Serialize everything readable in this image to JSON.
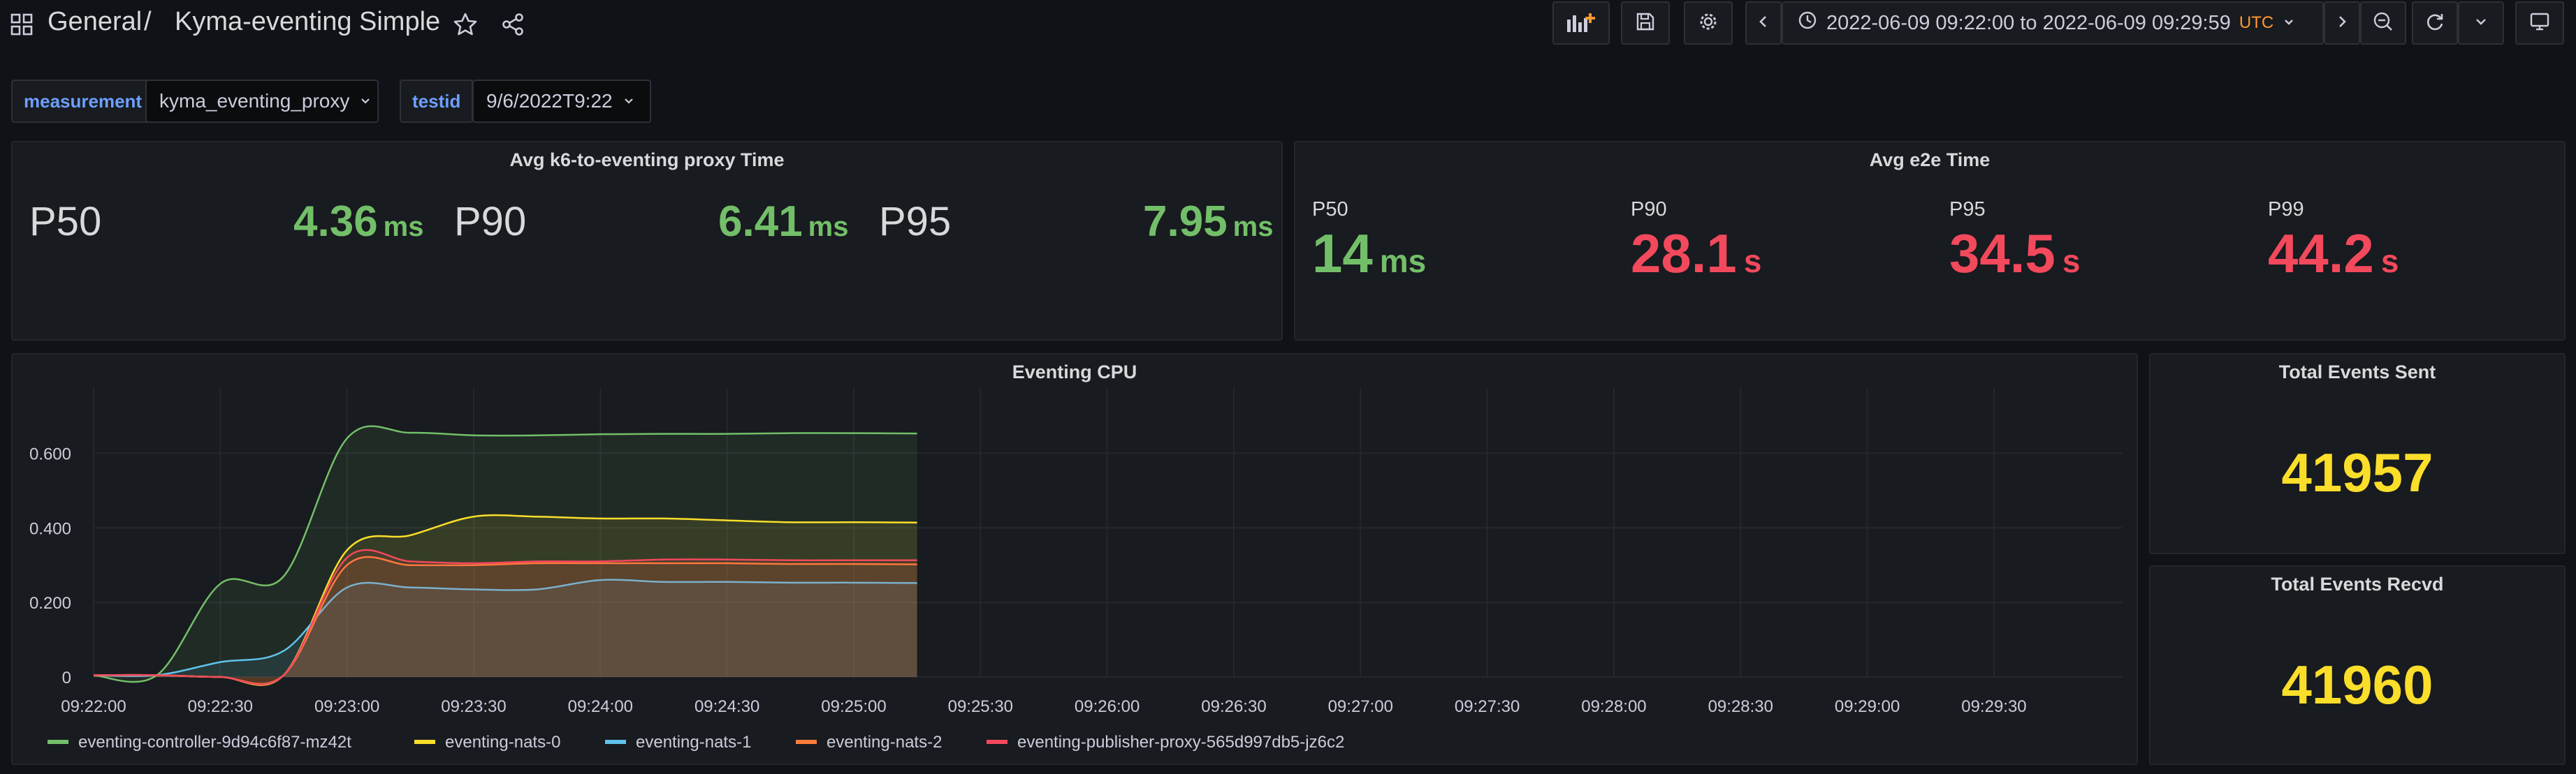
{
  "breadcrumb": {
    "folder": "General",
    "separator": "/",
    "dashboard": "Kyma-eventing Simple"
  },
  "toolbar": {
    "time_range": "2022-06-09 09:22:00 to 2022-06-09 09:29:59",
    "timezone": "UTC"
  },
  "variables": [
    {
      "label": "measurement",
      "value": "kyma_eventing_proxy"
    },
    {
      "label": "testid",
      "value": "9/6/2022T9:22"
    }
  ],
  "panels": {
    "proxy": {
      "title": "Avg k6-to-eventing proxy Time",
      "stats": [
        {
          "name": "P50",
          "value": "4.36",
          "unit": "ms"
        },
        {
          "name": "P90",
          "value": "6.41",
          "unit": "ms"
        },
        {
          "name": "P95",
          "value": "7.95",
          "unit": "ms"
        }
      ]
    },
    "e2e": {
      "title": "Avg e2e Time",
      "stats": [
        {
          "name": "P50",
          "value": "14",
          "unit": "ms"
        },
        {
          "name": "P90",
          "value": "28.1",
          "unit": "s"
        },
        {
          "name": "P95",
          "value": "34.5",
          "unit": "s"
        },
        {
          "name": "P99",
          "value": "44.2",
          "unit": "s"
        }
      ]
    },
    "sent": {
      "title": "Total Events Sent",
      "value": "41957"
    },
    "recvd": {
      "title": "Total Events Recvd",
      "value": "41960"
    }
  },
  "colors": {
    "background": "#111217",
    "panel": "#181b1f",
    "green": "#73bf69",
    "red": "#f2495c",
    "yellow": "#fade2a",
    "orange_utc": "#ff9830"
  },
  "chart_data": {
    "type": "area",
    "title": "Eventing CPU",
    "xlabel": "",
    "ylabel": "",
    "x_ticks": [
      "09:22:00",
      "09:22:30",
      "09:23:00",
      "09:23:30",
      "09:24:00",
      "09:24:30",
      "09:25:00",
      "09:25:30",
      "09:26:00",
      "09:26:30",
      "09:27:00",
      "09:27:30",
      "09:28:00",
      "09:28:30",
      "09:29:00",
      "09:29:30"
    ],
    "y_ticks": [
      "0",
      "0.200",
      "0.400",
      "0.600"
    ],
    "ylim": [
      0,
      0.7
    ],
    "grid": true,
    "legend_position": "bottom",
    "x": [
      "09:22:00",
      "09:22:15",
      "09:22:30",
      "09:22:45",
      "09:23:00",
      "09:23:15",
      "09:23:30",
      "09:23:45",
      "09:24:00",
      "09:24:15",
      "09:24:30",
      "09:24:45",
      "09:25:00",
      "09:25:15"
    ],
    "series": [
      {
        "name": "eventing-controller-9d94c6f87-mz42t",
        "color": "#73bf69",
        "values": [
          0.005,
          0.005,
          0.25,
          0.27,
          0.64,
          0.655,
          0.648,
          0.648,
          0.651,
          0.652,
          0.652,
          0.654,
          0.654,
          0.653
        ]
      },
      {
        "name": "eventing-nats-0",
        "color": "#fade2a",
        "values": [
          0.005,
          0.005,
          0.0,
          0.005,
          0.34,
          0.38,
          0.43,
          0.43,
          0.425,
          0.425,
          0.42,
          0.415,
          0.415,
          0.414
        ]
      },
      {
        "name": "eventing-nats-1",
        "color": "#5ec4ec",
        "values": [
          0.005,
          0.005,
          0.04,
          0.07,
          0.24,
          0.24,
          0.235,
          0.235,
          0.26,
          0.255,
          0.255,
          0.253,
          0.253,
          0.252
        ]
      },
      {
        "name": "eventing-nats-2",
        "color": "#ff7d3b",
        "values": [
          0.005,
          0.005,
          0.0,
          0.005,
          0.3,
          0.3,
          0.3,
          0.305,
          0.305,
          0.305,
          0.305,
          0.303,
          0.303,
          0.302
        ]
      },
      {
        "name": "eventing-publisher-proxy-565d997db5-jz6c2",
        "color": "#f2495c",
        "values": [
          0.005,
          0.005,
          0.0,
          0.005,
          0.32,
          0.31,
          0.305,
          0.31,
          0.31,
          0.315,
          0.315,
          0.313,
          0.313,
          0.313
        ]
      }
    ]
  }
}
